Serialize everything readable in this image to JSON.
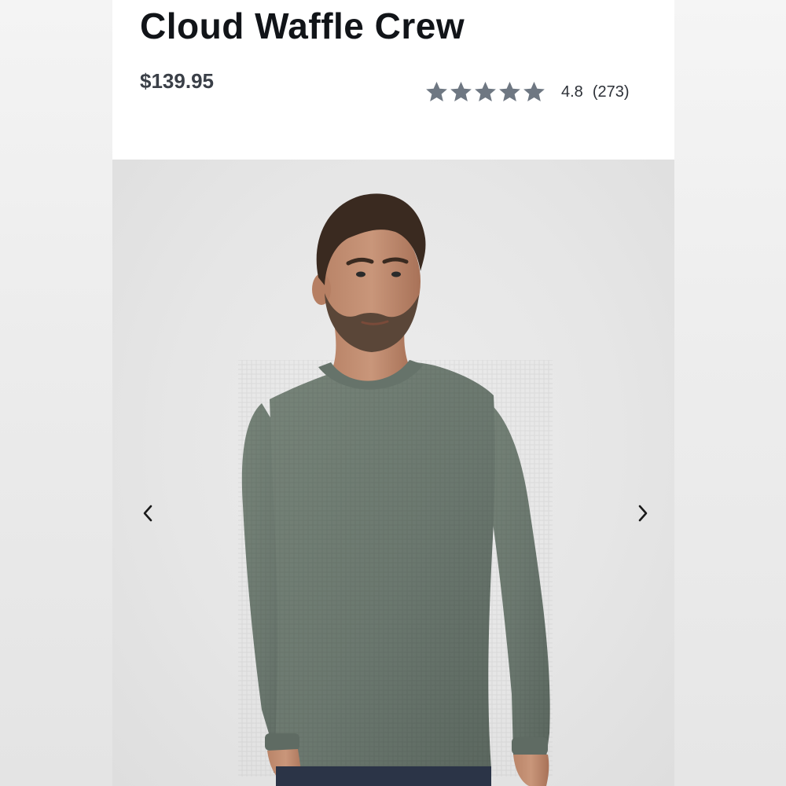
{
  "product": {
    "title": "Cloud Waffle Crew",
    "price": "$139.95",
    "rating": {
      "value": "4.8",
      "count": "(273)",
      "stars": 5
    }
  },
  "gallery": {
    "image_alt": "Man wearing sage green waffle-knit crew neck sweater",
    "prev_icon": "chevron-left-icon",
    "next_icon": "chevron-right-icon"
  },
  "colors": {
    "title": "#111418",
    "price": "#3a3f47",
    "star": "#6e7782",
    "sweater": "#6f7c74"
  }
}
